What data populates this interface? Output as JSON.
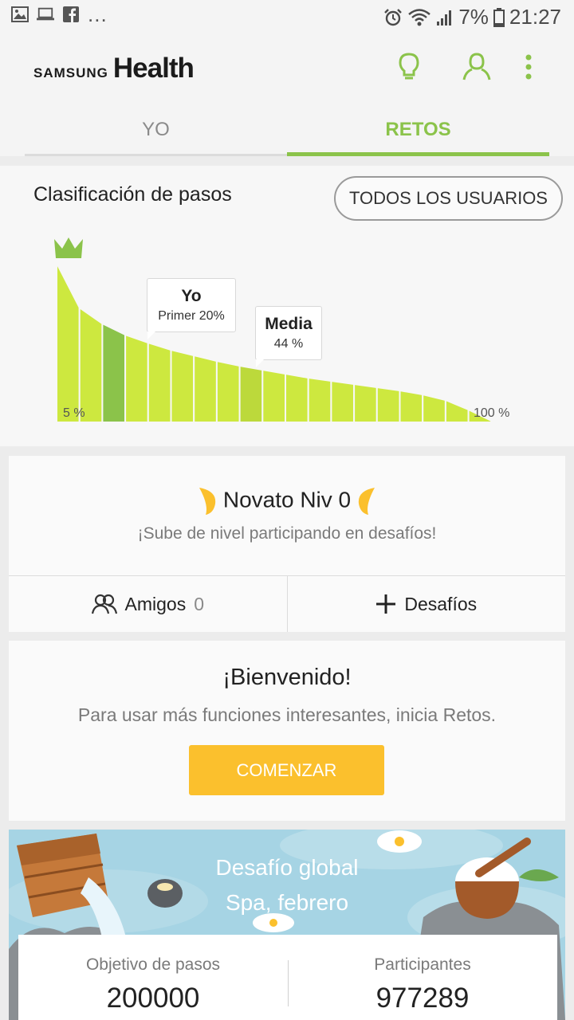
{
  "status_bar": {
    "battery": "7%",
    "time": "21:27",
    "overflow": "..."
  },
  "header": {
    "brand_samsung": "SAMSUNG",
    "brand_health": "Health",
    "tabs": [
      {
        "label": "YO",
        "selected": false
      },
      {
        "label": "RETOS",
        "selected": true
      }
    ],
    "accent_color": "#8bc34a"
  },
  "ranking": {
    "title": "Clasificación de pasos",
    "filter_button": "TODOS LOS USUARIOS",
    "callout_me": {
      "title": "Yo",
      "value": "Primer 20%"
    },
    "callout_average": {
      "title": "Media",
      "value": "44 %"
    },
    "axis_start": "5 %",
    "axis_end": "100 %"
  },
  "chart_data": {
    "type": "area",
    "x": [
      "5 %",
      "10 %",
      "15 %",
      "20 %",
      "25 %",
      "30 %",
      "35 %",
      "40 %",
      "45 %",
      "50 %",
      "55 %",
      "60 %",
      "65 %",
      "70 %",
      "75 %",
      "80 %",
      "85 %",
      "90 %",
      "95 %",
      "100 %"
    ],
    "values": [
      100,
      72,
      62,
      55,
      50,
      45.5,
      42,
      38.5,
      35.5,
      33,
      30.5,
      28,
      26,
      24,
      22,
      20,
      17.5,
      14,
      8,
      1
    ],
    "highlight": {
      "me_percentile": "20 %",
      "average_percentile": "44 %"
    },
    "grid": false
  },
  "level": {
    "title": "Novato Niv 0",
    "subtitle": "¡Sube de nivel participando en desafíos!",
    "friends_label": "Amigos",
    "friends_count": "0",
    "challenges_label": "Desafíos"
  },
  "welcome": {
    "title": "¡Bienvenido!",
    "subtitle": "Para usar más funciones interesantes, inicia Retos.",
    "button": "COMENZAR",
    "button_color": "#fbc02d"
  },
  "challenge": {
    "title_line1": "Desafío global",
    "title_line2": "Spa, febrero",
    "goal_label": "Objetivo de pasos",
    "goal_value": "200000",
    "participants_label": "Participantes",
    "participants_value": "977289"
  }
}
